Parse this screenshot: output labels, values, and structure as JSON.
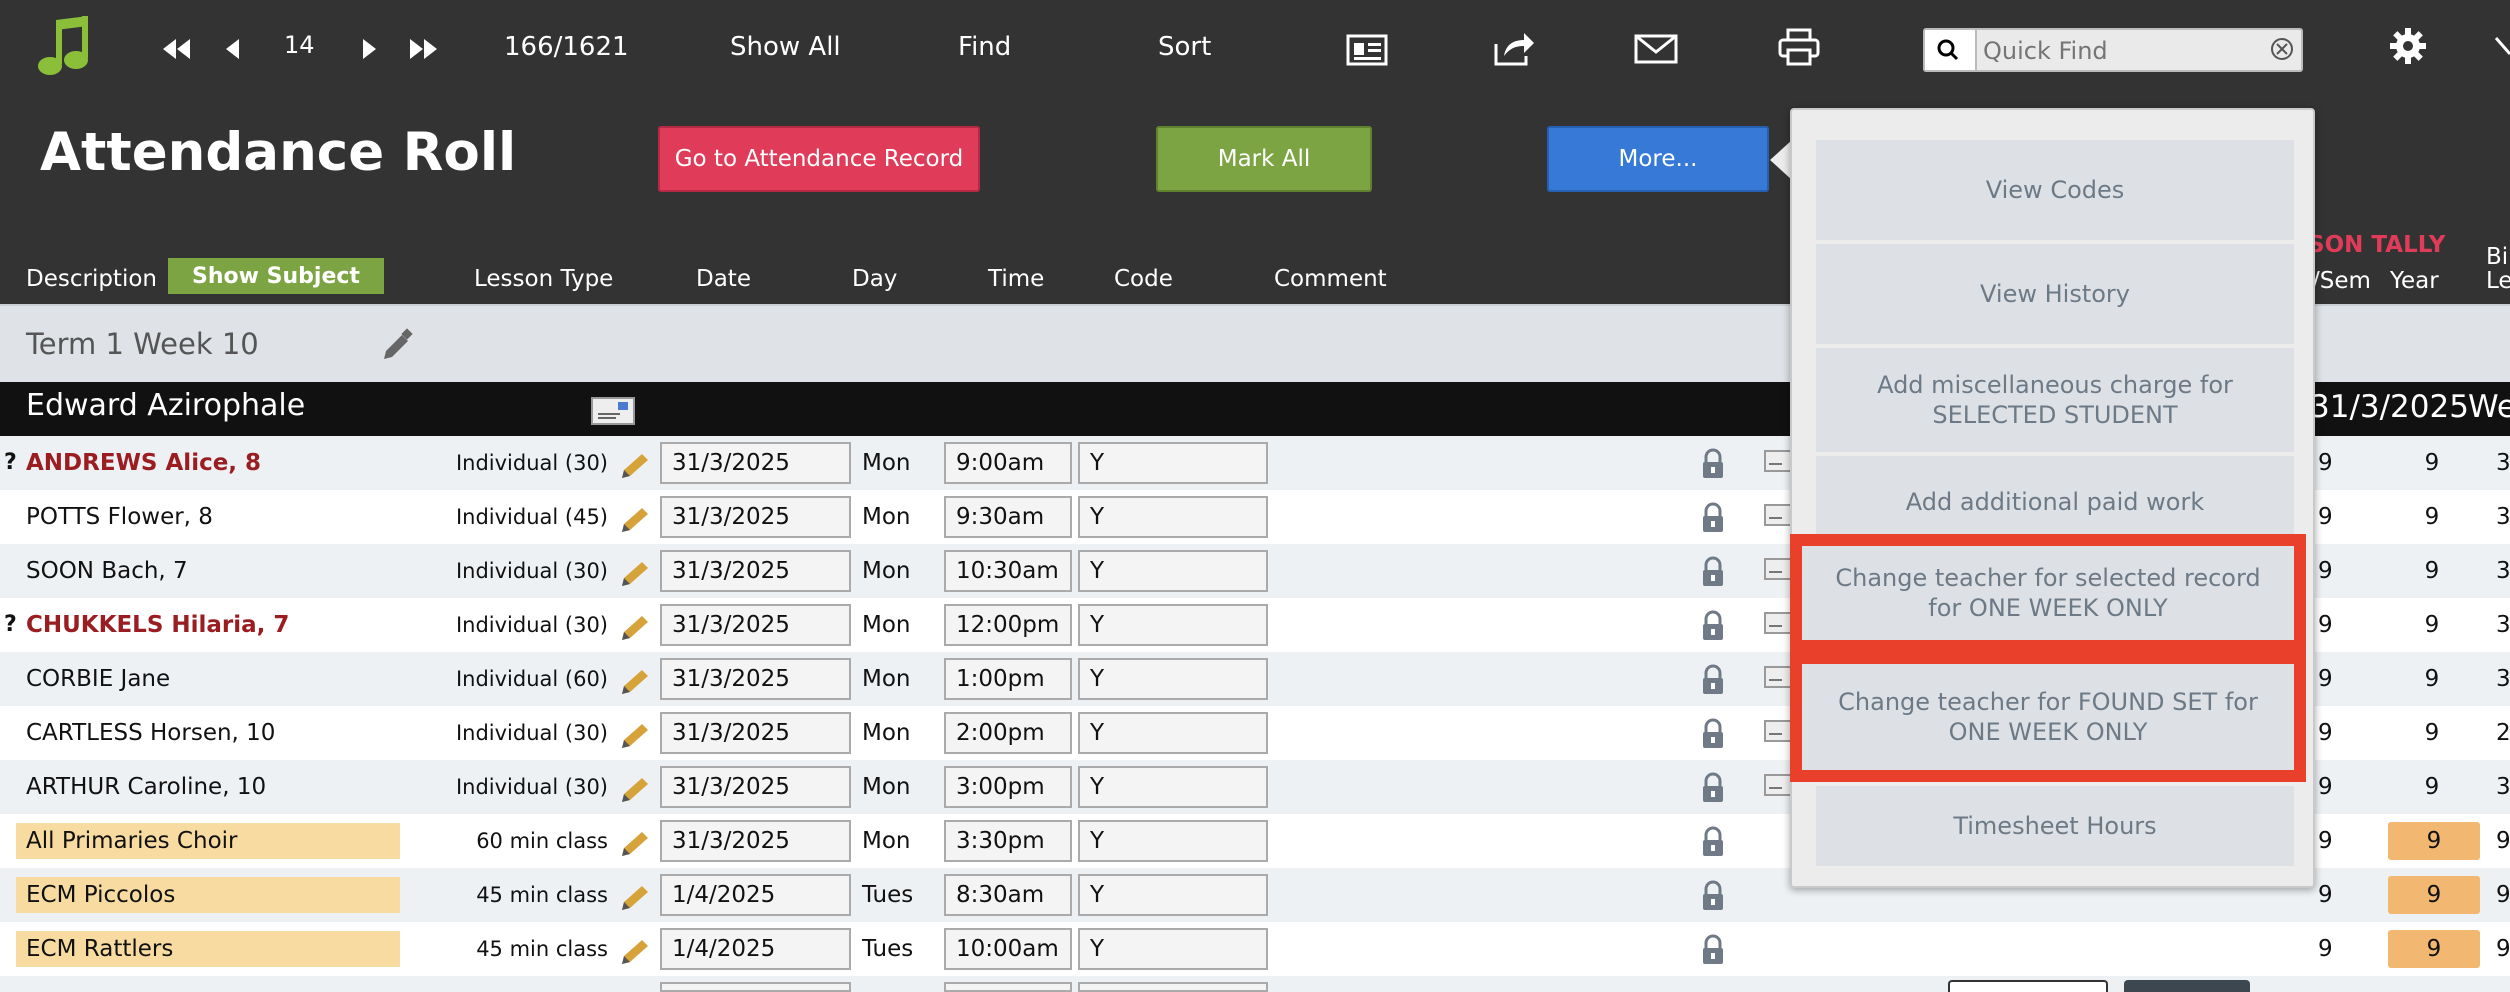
{
  "toolbar": {
    "record_number": "14",
    "record_count": "166/1621",
    "show_all": "Show All",
    "find": "Find",
    "sort": "Sort",
    "quick_find_placeholder": "Quick Find"
  },
  "header": {
    "title": "Attendance Roll",
    "goto_button": "Go to Attendance Record",
    "mark_all_button": "Mark All",
    "more_button": "More...",
    "show_subject_button": "Show Subject",
    "columns": {
      "description": "Description",
      "lesson_type": "Lesson Type",
      "date": "Date",
      "day": "Day",
      "time": "Time",
      "code": "Code",
      "comment": "Comment"
    },
    "tally_label": "SON TALLY",
    "tally_sem": "/Sem",
    "tally_year": "Year",
    "cut_bi": "Bi",
    "cut_le": "Le"
  },
  "term": {
    "label": "Term 1 Week 10"
  },
  "teacher": {
    "name": "Edward Azirophale",
    "date": "31/3/2025",
    "cut_we": "We"
  },
  "rows": [
    {
      "q": "?",
      "name": "ANDREWS Alice, 8",
      "style": "red",
      "lesson": "Individual (30)",
      "date": "31/3/2025",
      "day": "Mon",
      "time": "9:00am",
      "code": "Y",
      "sem": "9",
      "year": "9",
      "extra": "3",
      "orange": false,
      "envelope": true
    },
    {
      "q": "",
      "name": "POTTS Flower, 8",
      "style": "normal",
      "lesson": "Individual (45)",
      "date": "31/3/2025",
      "day": "Mon",
      "time": "9:30am",
      "code": "Y",
      "sem": "9",
      "year": "9",
      "extra": "3",
      "orange": false,
      "envelope": true
    },
    {
      "q": "",
      "name": "SOON Bach, 7",
      "style": "normal",
      "lesson": "Individual (30)",
      "date": "31/3/2025",
      "day": "Mon",
      "time": "10:30am",
      "code": "Y",
      "sem": "9",
      "year": "9",
      "extra": "3",
      "orange": false,
      "envelope": true
    },
    {
      "q": "?",
      "name": "CHUKKELS Hilaria, 7",
      "style": "red",
      "lesson": "Individual (30)",
      "date": "31/3/2025",
      "day": "Mon",
      "time": "12:00pm",
      "code": "Y",
      "sem": "9",
      "year": "9",
      "extra": "3",
      "orange": false,
      "envelope": true
    },
    {
      "q": "",
      "name": "CORBIE Jane",
      "style": "normal",
      "lesson": "Individual (60)",
      "date": "31/3/2025",
      "day": "Mon",
      "time": "1:00pm",
      "code": "Y",
      "sem": "9",
      "year": "9",
      "extra": "3",
      "orange": false,
      "envelope": true
    },
    {
      "q": "",
      "name": "CARTLESS Horsen, 10",
      "style": "normal",
      "lesson": "Individual (30)",
      "date": "31/3/2025",
      "day": "Mon",
      "time": "2:00pm",
      "code": "Y",
      "sem": "9",
      "year": "9",
      "extra": "2",
      "orange": false,
      "envelope": true
    },
    {
      "q": "",
      "name": "ARTHUR Caroline, 10",
      "style": "normal",
      "lesson": "Individual (30)",
      "date": "31/3/2025",
      "day": "Mon",
      "time": "3:00pm",
      "code": "Y",
      "sem": "9",
      "year": "9",
      "extra": "3",
      "orange": false,
      "envelope": true
    },
    {
      "q": "",
      "name": "All Primaries Choir",
      "style": "ensemble",
      "lesson": "60 min class",
      "date": "31/3/2025",
      "day": "Mon",
      "time": "3:30pm",
      "code": "Y",
      "sem": "9",
      "year": "9",
      "extra": "9",
      "orange": true,
      "envelope": false
    },
    {
      "q": "",
      "name": "ECM Piccolos",
      "style": "ensemble",
      "lesson": "45 min class",
      "date": "1/4/2025",
      "day": "Tues",
      "time": "8:30am",
      "code": "Y",
      "sem": "9",
      "year": "9",
      "extra": "9",
      "orange": true,
      "envelope": false
    },
    {
      "q": "",
      "name": "ECM Rattlers",
      "style": "ensemble",
      "lesson": "45 min class",
      "date": "1/4/2025",
      "day": "Tues",
      "time": "10:00am",
      "code": "Y",
      "sem": "9",
      "year": "9",
      "extra": "9",
      "orange": true,
      "envelope": false
    }
  ],
  "more_menu": {
    "items": [
      {
        "label": "View Codes",
        "highlighted": false
      },
      {
        "label": "View History",
        "highlighted": false
      },
      {
        "label": "Add miscellaneous charge for SELECTED STUDENT",
        "highlighted": false
      },
      {
        "label": "Add additional paid work",
        "highlighted": false
      },
      {
        "label": "Change teacher for selected record for ONE WEEK ONLY",
        "highlighted": true
      },
      {
        "label": "Change teacher for FOUND SET for ONE WEEK ONLY",
        "highlighted": true
      },
      {
        "label": "Timesheet Hours",
        "highlighted": false
      }
    ]
  },
  "colors": {
    "toolbar_bg": "#333333",
    "brand_green": "#7da443",
    "goto_pink": "#e03c5a",
    "more_blue": "#3679d6",
    "highlight_red": "#e8402a",
    "ensemble_bg": "#f8dba0",
    "orange_pill": "#f2b872",
    "name_red": "#9a1d22"
  },
  "icons": [
    "music-note-icon",
    "first-record-icon",
    "previous-record-icon",
    "next-record-icon",
    "last-record-icon",
    "contact-card-icon",
    "share-icon",
    "mail-icon",
    "print-icon",
    "search-icon",
    "clear-icon",
    "gear-icon",
    "close-icon",
    "edit-pencil-icon",
    "envelope-icon",
    "lock-icon"
  ]
}
